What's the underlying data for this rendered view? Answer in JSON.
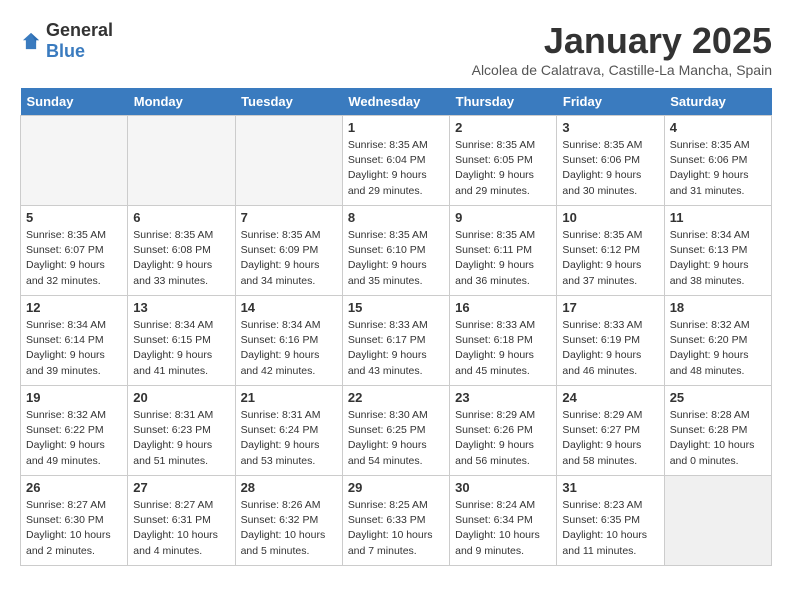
{
  "logo": {
    "general": "General",
    "blue": "Blue"
  },
  "title": "January 2025",
  "subtitle": "Alcolea de Calatrava, Castille-La Mancha, Spain",
  "headers": [
    "Sunday",
    "Monday",
    "Tuesday",
    "Wednesday",
    "Thursday",
    "Friday",
    "Saturday"
  ],
  "weeks": [
    [
      {
        "day": "",
        "info": ""
      },
      {
        "day": "",
        "info": ""
      },
      {
        "day": "",
        "info": ""
      },
      {
        "day": "1",
        "info": "Sunrise: 8:35 AM\nSunset: 6:04 PM\nDaylight: 9 hours\nand 29 minutes."
      },
      {
        "day": "2",
        "info": "Sunrise: 8:35 AM\nSunset: 6:05 PM\nDaylight: 9 hours\nand 29 minutes."
      },
      {
        "day": "3",
        "info": "Sunrise: 8:35 AM\nSunset: 6:06 PM\nDaylight: 9 hours\nand 30 minutes."
      },
      {
        "day": "4",
        "info": "Sunrise: 8:35 AM\nSunset: 6:06 PM\nDaylight: 9 hours\nand 31 minutes."
      }
    ],
    [
      {
        "day": "5",
        "info": "Sunrise: 8:35 AM\nSunset: 6:07 PM\nDaylight: 9 hours\nand 32 minutes."
      },
      {
        "day": "6",
        "info": "Sunrise: 8:35 AM\nSunset: 6:08 PM\nDaylight: 9 hours\nand 33 minutes."
      },
      {
        "day": "7",
        "info": "Sunrise: 8:35 AM\nSunset: 6:09 PM\nDaylight: 9 hours\nand 34 minutes."
      },
      {
        "day": "8",
        "info": "Sunrise: 8:35 AM\nSunset: 6:10 PM\nDaylight: 9 hours\nand 35 minutes."
      },
      {
        "day": "9",
        "info": "Sunrise: 8:35 AM\nSunset: 6:11 PM\nDaylight: 9 hours\nand 36 minutes."
      },
      {
        "day": "10",
        "info": "Sunrise: 8:35 AM\nSunset: 6:12 PM\nDaylight: 9 hours\nand 37 minutes."
      },
      {
        "day": "11",
        "info": "Sunrise: 8:34 AM\nSunset: 6:13 PM\nDaylight: 9 hours\nand 38 minutes."
      }
    ],
    [
      {
        "day": "12",
        "info": "Sunrise: 8:34 AM\nSunset: 6:14 PM\nDaylight: 9 hours\nand 39 minutes."
      },
      {
        "day": "13",
        "info": "Sunrise: 8:34 AM\nSunset: 6:15 PM\nDaylight: 9 hours\nand 41 minutes."
      },
      {
        "day": "14",
        "info": "Sunrise: 8:34 AM\nSunset: 6:16 PM\nDaylight: 9 hours\nand 42 minutes."
      },
      {
        "day": "15",
        "info": "Sunrise: 8:33 AM\nSunset: 6:17 PM\nDaylight: 9 hours\nand 43 minutes."
      },
      {
        "day": "16",
        "info": "Sunrise: 8:33 AM\nSunset: 6:18 PM\nDaylight: 9 hours\nand 45 minutes."
      },
      {
        "day": "17",
        "info": "Sunrise: 8:33 AM\nSunset: 6:19 PM\nDaylight: 9 hours\nand 46 minutes."
      },
      {
        "day": "18",
        "info": "Sunrise: 8:32 AM\nSunset: 6:20 PM\nDaylight: 9 hours\nand 48 minutes."
      }
    ],
    [
      {
        "day": "19",
        "info": "Sunrise: 8:32 AM\nSunset: 6:22 PM\nDaylight: 9 hours\nand 49 minutes."
      },
      {
        "day": "20",
        "info": "Sunrise: 8:31 AM\nSunset: 6:23 PM\nDaylight: 9 hours\nand 51 minutes."
      },
      {
        "day": "21",
        "info": "Sunrise: 8:31 AM\nSunset: 6:24 PM\nDaylight: 9 hours\nand 53 minutes."
      },
      {
        "day": "22",
        "info": "Sunrise: 8:30 AM\nSunset: 6:25 PM\nDaylight: 9 hours\nand 54 minutes."
      },
      {
        "day": "23",
        "info": "Sunrise: 8:29 AM\nSunset: 6:26 PM\nDaylight: 9 hours\nand 56 minutes."
      },
      {
        "day": "24",
        "info": "Sunrise: 8:29 AM\nSunset: 6:27 PM\nDaylight: 9 hours\nand 58 minutes."
      },
      {
        "day": "25",
        "info": "Sunrise: 8:28 AM\nSunset: 6:28 PM\nDaylight: 10 hours\nand 0 minutes."
      }
    ],
    [
      {
        "day": "26",
        "info": "Sunrise: 8:27 AM\nSunset: 6:30 PM\nDaylight: 10 hours\nand 2 minutes."
      },
      {
        "day": "27",
        "info": "Sunrise: 8:27 AM\nSunset: 6:31 PM\nDaylight: 10 hours\nand 4 minutes."
      },
      {
        "day": "28",
        "info": "Sunrise: 8:26 AM\nSunset: 6:32 PM\nDaylight: 10 hours\nand 5 minutes."
      },
      {
        "day": "29",
        "info": "Sunrise: 8:25 AM\nSunset: 6:33 PM\nDaylight: 10 hours\nand 7 minutes."
      },
      {
        "day": "30",
        "info": "Sunrise: 8:24 AM\nSunset: 6:34 PM\nDaylight: 10 hours\nand 9 minutes."
      },
      {
        "day": "31",
        "info": "Sunrise: 8:23 AM\nSunset: 6:35 PM\nDaylight: 10 hours\nand 11 minutes."
      },
      {
        "day": "",
        "info": ""
      }
    ]
  ]
}
